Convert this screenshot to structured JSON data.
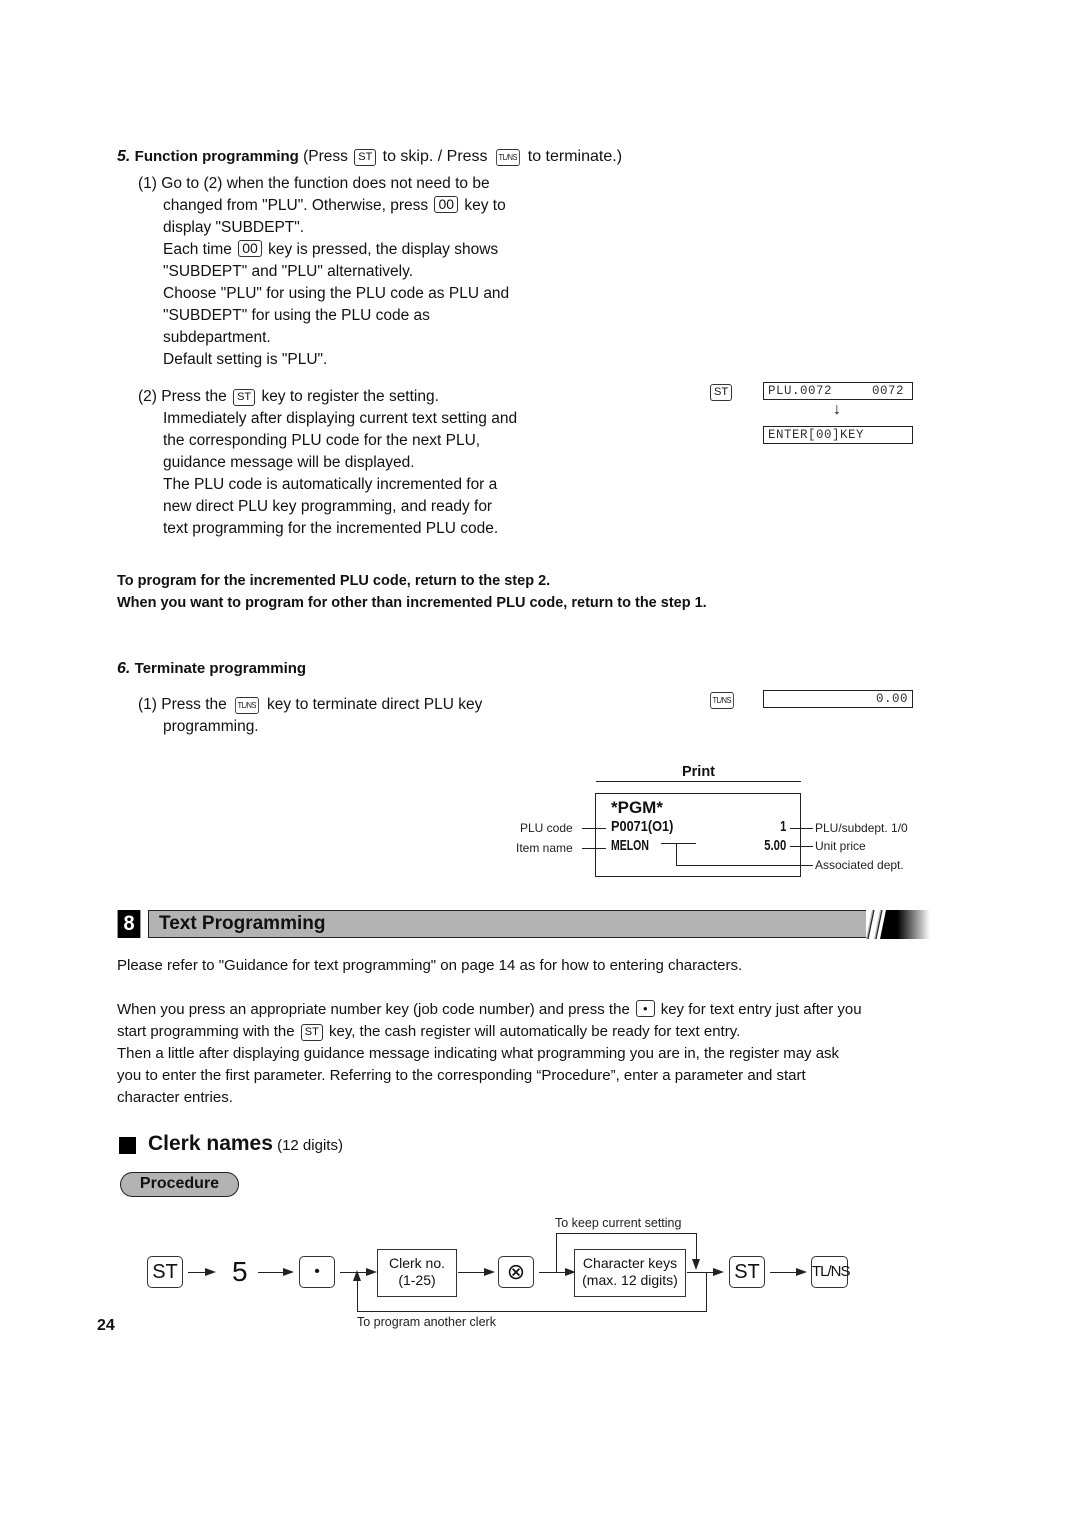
{
  "step5": {
    "num": "5.",
    "title": "Function programming",
    "note_pre": "(Press",
    "note_mid": "to skip. / Press",
    "note_post": "to terminate.)",
    "key_st": "ST",
    "key_tlns": "TL/NS",
    "sub1": {
      "num": "(1)",
      "lines": [
        "Go to (2) when the function does not need to be",
        "changed from \"PLU\".  Otherwise, press",
        "display \"SUBDEPT\".",
        "Each time",
        "\"SUBDEPT\" and \"PLU\" alternatively.",
        "Choose \"PLU\" for using the PLU code as PLU and",
        "\"SUBDEPT\" for using the PLU code as",
        "subdepartment.",
        "Default setting is \"PLU\"."
      ],
      "line2_post": "key to",
      "line4_post": "key is pressed, the display shows",
      "key_00": "00"
    },
    "sub2": {
      "num": "(2)",
      "line1_pre": "Press the",
      "line1_post": "key to register the setting.",
      "lines": [
        "Immediately after displaying current text setting and",
        "the corresponding PLU code for the next PLU,",
        "guidance message will be displayed.",
        "The PLU code is automatically incremented for a",
        "new direct PLU key programming, and ready for",
        "text programming for the incremented PLU code."
      ],
      "side_key": "ST",
      "display1": "PLU.0072     0072",
      "display2": "ENTER[00]KEY",
      "arrow": "↓"
    }
  },
  "notes": [
    "To program for the incremented PLU code, return to the step 2.",
    "When you want to program for other than incremented PLU code, return to the step 1."
  ],
  "step6": {
    "num": "6.",
    "title": "Terminate programming",
    "sub1_num": "(1)",
    "sub1_pre": "Press the",
    "sub1_post": "key to terminate direct PLU key",
    "sub1_line2": "programming.",
    "key_tlns": "TL/NS",
    "display": "0.00"
  },
  "print": {
    "title": "Print",
    "receipt": {
      "header": "*PGM*",
      "code": "P0071(O1)",
      "qty": "1",
      "name": "MELON",
      "price": "5.00"
    },
    "labels": {
      "plu_code": "PLU code",
      "item_name": "Item name",
      "plu_subdept": "PLU/subdept.   1/0",
      "unit_price": "Unit price",
      "assoc_dept": "Associated dept."
    }
  },
  "section": {
    "number": "8",
    "title": "Text Programming"
  },
  "body": {
    "p1": "Please refer to \"Guidance for text programming\" on page 14 as for how to entering characters.",
    "p2_l1_pre": "When you press an appropriate number key (job code number) and press the",
    "p2_l1_post": "key for text entry just after you",
    "p2_l2_pre": "start programming with the",
    "p2_l2_post": "key, the cash register will automatically be ready for text entry.",
    "p2_l3": "Then a little after displaying guidance message indicating what programming you are in, the register may ask",
    "p2_l4": "you to enter the first parameter.  Referring to the corresponding “Procedure”, enter a parameter and start",
    "p2_l5": "character entries.",
    "key_dot": "•",
    "key_st": "ST"
  },
  "clerk": {
    "title": "Clerk names",
    "digits": "(12 digits)",
    "procedure_label": "Procedure",
    "flow": {
      "st": "ST",
      "five": "5",
      "dot": "•",
      "clerk_box_l1": "Clerk no.",
      "clerk_box_l2": "(1-25)",
      "multiply": "⊗",
      "char_box_l1": "Character keys",
      "char_box_l2": "(max. 12 digits)",
      "st2": "ST",
      "tlns": "TL/NS",
      "keep_label": "To keep current setting",
      "loop_label": "To program another clerk"
    }
  },
  "page_number": "24"
}
